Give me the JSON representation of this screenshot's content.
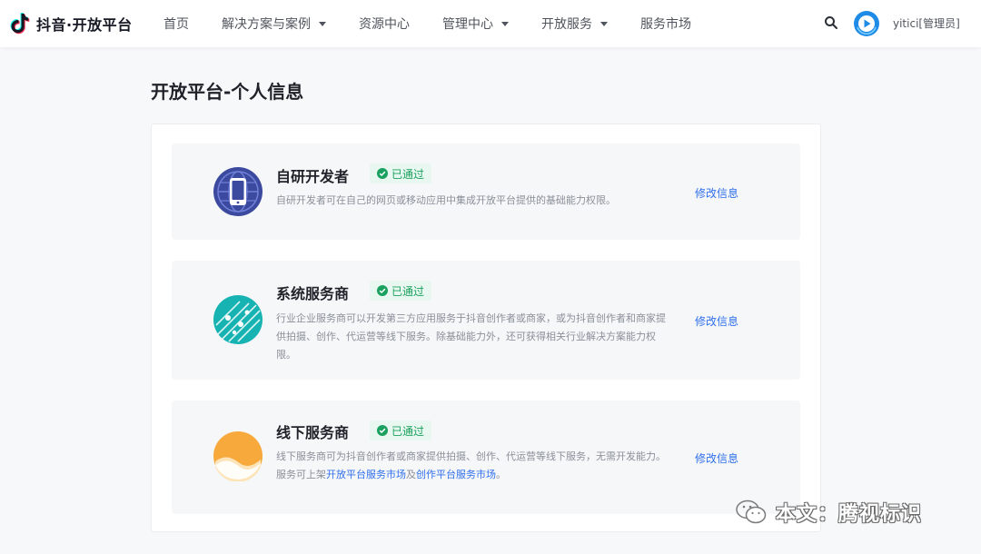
{
  "header": {
    "logo_text": "抖音·开放平台",
    "nav": [
      {
        "label": "首页",
        "has_dropdown": false
      },
      {
        "label": "解决方案与案例",
        "has_dropdown": true
      },
      {
        "label": "资源中心",
        "has_dropdown": false
      },
      {
        "label": "管理中心",
        "has_dropdown": true
      },
      {
        "label": "开放服务",
        "has_dropdown": true
      },
      {
        "label": "服务市场",
        "has_dropdown": false
      }
    ],
    "search_icon": "search-icon",
    "username": "yitici[管理员]"
  },
  "page": {
    "title": "开放平台-个人信息"
  },
  "cards": [
    {
      "title": "自研开发者",
      "badge": "已通过",
      "description": "自研开发者可在自己的网页或移动应用中集成开放平台提供的基础能力权限。",
      "edit_label": "修改信息",
      "icon": "mobile-globe-icon"
    },
    {
      "title": "系统服务商",
      "badge": "已通过",
      "description": "行业企业服务商可以开发第三方应用服务于抖音创作者或商家，或为抖音创作者和商家提供拍摄、创作、代运营等线下服务。除基础能力外，还可获得相关行业解决方案能力权限。",
      "edit_label": "修改信息",
      "icon": "network-icon"
    },
    {
      "title": "线下服务商",
      "badge": "已通过",
      "description_before": "线下服务商可为抖音创作者或商家提供拍摄、创作、代运营等线下服务，无需开发能力。服务可上架",
      "link1": "开放平台服务市场",
      "description_mid": "及",
      "link2": "创作平台服务市场",
      "description_after": "。",
      "edit_label": "修改信息",
      "icon": "landscape-icon"
    }
  ],
  "watermark": {
    "text": "本文：腾视标识",
    "icon": "wechat-icon"
  },
  "colors": {
    "accent": "#2f6feb",
    "badge_green": "#1aa15f",
    "badge_bg": "#e8f7ef"
  }
}
